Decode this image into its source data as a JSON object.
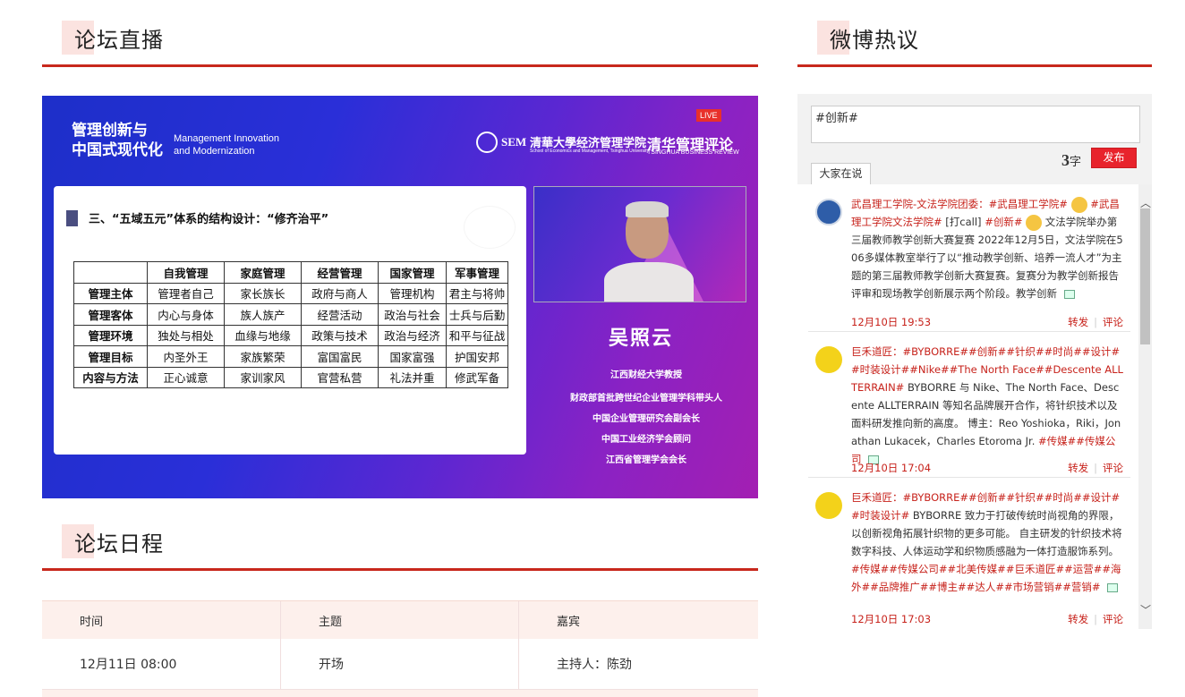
{
  "sections": {
    "live": "论坛直播",
    "weibo": "微博热议",
    "schedule": "论坛日程"
  },
  "video": {
    "header_cn_line1": "管理创新与",
    "header_cn_line2": "中国式现代化",
    "header_en_line1": "Management Innovation",
    "header_en_line2": "and Modernization",
    "sem": "SEM",
    "school": "清華大學经济管理学院",
    "school_en": "School of Economics and Management, Tsinghua University",
    "review": "清华管理评论",
    "review_en": "TSINGHUA BUSINESS REVIEW",
    "live_badge": "LIVE",
    "slide_heading": "三、“五域五元”体系的结构设计：“修齐治平”",
    "table": {
      "header": [
        "",
        "自我管理",
        "家庭管理",
        "经营管理",
        "国家管理",
        "军事管理"
      ],
      "rows": [
        [
          "管理主体",
          "管理者自己",
          "家长族长",
          "政府与商人",
          "管理机构",
          "君主与将帅"
        ],
        [
          "管理客体",
          "内心与身体",
          "族人族产",
          "经营活动",
          "政治与社会",
          "士兵与后勤"
        ],
        [
          "管理环境",
          "独处与相处",
          "血缘与地缘",
          "政策与技术",
          "政治与经济",
          "和平与征战"
        ],
        [
          "管理目标",
          "内圣外王",
          "家族繁荣",
          "富国富民",
          "国家富强",
          "护国安邦"
        ],
        [
          "内容与方法",
          "正心诚意",
          "家训家风",
          "官营私营",
          "礼法并重",
          "修武军备"
        ]
      ]
    },
    "speaker": {
      "name": "吴照云",
      "titles": [
        "江西财经大学教授",
        "财政部首批跨世纪企业管理学科带头人",
        "中国企业管理研究会副会长",
        "中国工业经济学会顾问",
        "江西省管理学会会长"
      ]
    }
  },
  "weibo": {
    "input_value": "#创新#",
    "count_num": "3",
    "count_unit": "字",
    "send_label": "发布",
    "tab_label": "大家在说",
    "posts": [
      {
        "text_red": "武昌理工学院-文法学院团委：#武昌理工学院#",
        "text_red2": "#武昌理工学院文法学院# ",
        "text_black1": "[打call]",
        "text_red3": "#创新# ",
        "text_black2": "文法学院举办第三届教师教学创新大赛复赛 2022年12月5日，文法学院在506多媒体教室举行了以“推动教学创新、培养一流人才”为主题的第三届教师教学创新大赛复赛。复赛分为教学创新报告评审和现场教学创新展示两个阶段。教学创新",
        "time": "12月10日 19:53",
        "repost": "转发",
        "comment": "评论"
      },
      {
        "text_red": "巨禾道匠：#BYBORRE##创新##针织##时尚##设计##时装设计##Nike##The North Face##Descente ALLTERRAIN#",
        "text_black2": " BYBORRE 与 Nike、The North Face、Descente ALLTERRAIN 等知名品牌展开合作，将针织技术以及面料研发推向新的高度。 博主：Reo Yoshioka，Riki，Jonathan Lukacek，Charles Etoroma Jr. ",
        "text_red3": "#传媒##传媒公司",
        "time": "12月10日 17:04",
        "repost": "转发",
        "comment": "评论"
      },
      {
        "text_red": "巨禾道匠：#BYBORRE##创新##针织##时尚##设计##时装设计#",
        "text_black2": " BYBORRE 致力于打破传统时尚视角的界限，以创新视角拓展针织物的更多可能。 自主研发的针织技术将数字科技、人体运动学和织物质感融为一体打造服饰系列。 ",
        "text_red3": "#传媒##传媒公司##北美传媒##巨禾道匠##运营##海外##品牌推广##博主##达人##市场营销##营销#",
        "time": "12月10日 17:03",
        "repost": "转发",
        "comment": "评论"
      }
    ]
  },
  "schedule": {
    "headers": [
      "时间",
      "主题",
      "嘉宾"
    ],
    "rows": [
      [
        "12月11日 08:00",
        "开场",
        "主持人：陈劲"
      ]
    ]
  }
}
